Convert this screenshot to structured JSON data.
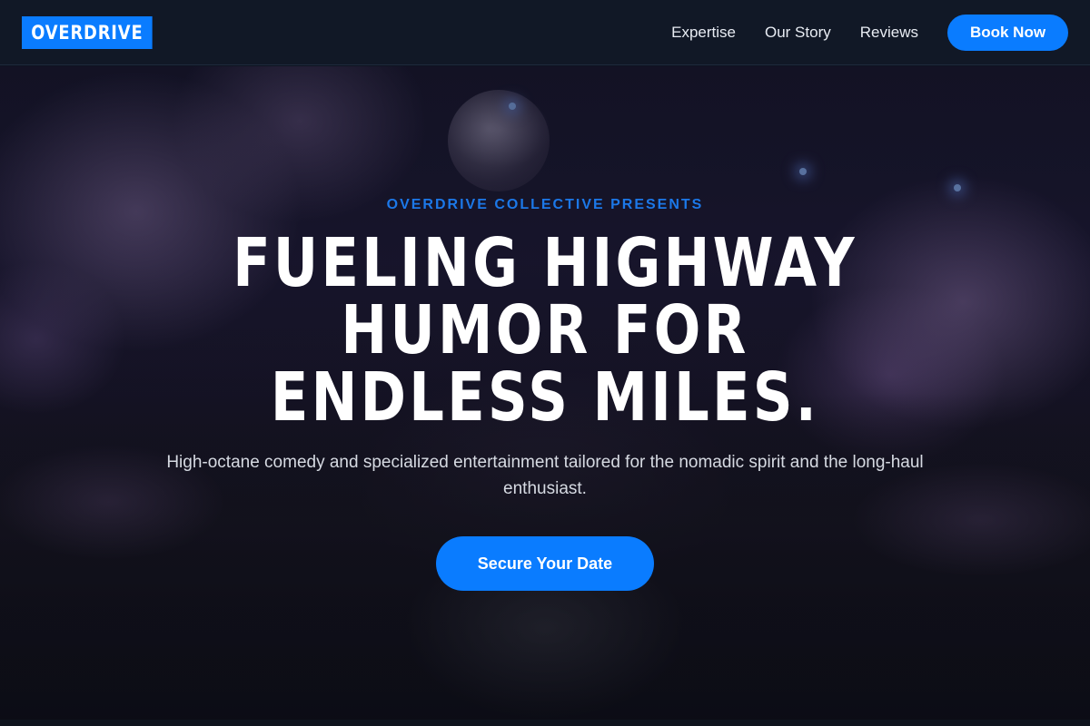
{
  "nav": {
    "logo": "OVERDRIVE",
    "links": [
      "Expertise",
      "Our Story",
      "Reviews"
    ],
    "cta_label": "Book Now"
  },
  "hero": {
    "eyebrow": "OVERDRIVE COLLECTIVE PRESENTS",
    "headline": "FUELING HIGHWAY HUMOR FOR ENDLESS MILES.",
    "subtitle": "High-octane comedy and specialized entertainment tailored for the nomadic spirit and the long-haul enthusiast.",
    "cta_label": "Secure Your Date"
  },
  "colors": {
    "accent": "#0a7cff",
    "navbar_bg": "#111826"
  }
}
